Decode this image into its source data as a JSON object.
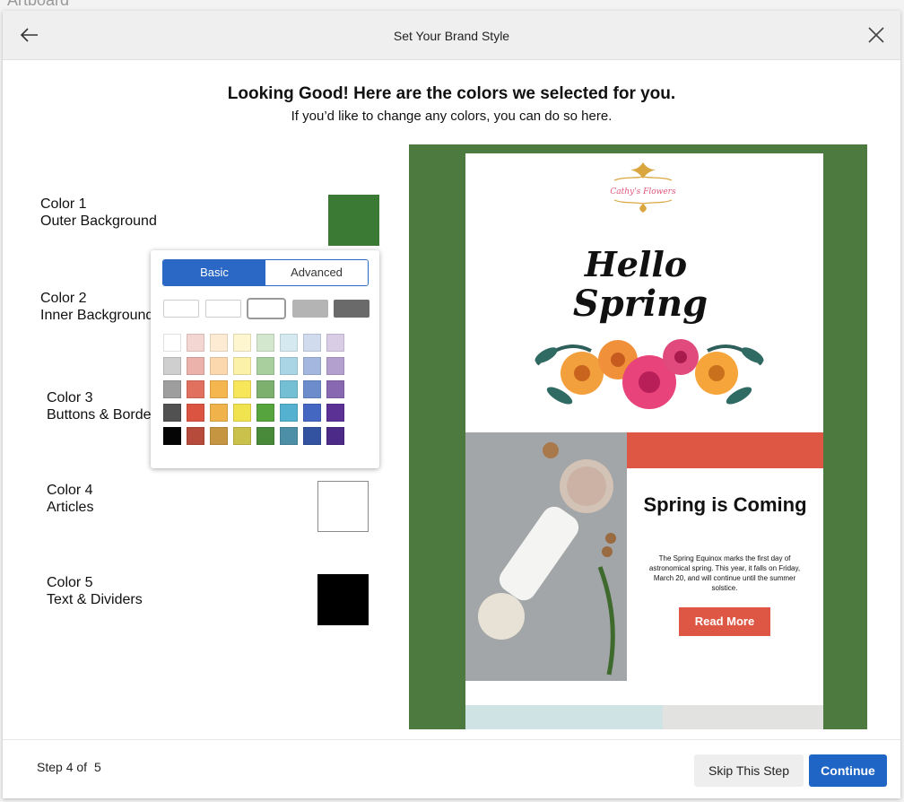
{
  "artboard_label": "Artboard",
  "header": {
    "title": "Set Your Brand Style"
  },
  "intro": {
    "headline": "Looking Good! Here are the colors we selected for you.",
    "subline": "If you’d like to change any colors, you can do so here."
  },
  "colors": [
    {
      "name": "Color 1",
      "role": "Outer Background",
      "value": "#3a7a35"
    },
    {
      "name": "Color 2",
      "role": "Inner Background",
      "value": "#ffffff"
    },
    {
      "name": "Color 3",
      "role": "Buttons & Borders",
      "value": "#dd5744"
    },
    {
      "name": "Color 4",
      "role": "Articles",
      "value": "#ffffff"
    },
    {
      "name": "Color 5",
      "role": "Text & Dividers",
      "value": "#000000"
    }
  ],
  "picker": {
    "tabs": [
      "Basic",
      "Advanced"
    ],
    "presets": [
      "#ffffff",
      "#ffffff",
      "#ffffff",
      "#b4b4b4",
      "#6a6a6a"
    ],
    "grid": [
      [
        "#ffffff",
        "#f3d6d2",
        "#fdebd4",
        "#fdf6cf",
        "#d3e7cf",
        "#d5e9f1",
        "#d0dbed",
        "#d9cde5",
        "#ecd1e6"
      ],
      [
        "#cfcfcf",
        "#ebb2ab",
        "#fbd8ae",
        "#fbf1a8",
        "#a9cf9f",
        "#a9d5e5",
        "#a4b7df",
        "#b3a0ce",
        "#dbadd5"
      ],
      [
        "#9e9e9e",
        "#e1705f",
        "#f6b64f",
        "#f7e65a",
        "#7db06f",
        "#74bfd4",
        "#6d8ccc",
        "#8869b1",
        "#c36fb8"
      ],
      [
        "#515151",
        "#db5442",
        "#f0b34b",
        "#f1e34f",
        "#56a43e",
        "#55b1d0",
        "#4467c2",
        "#5b3196",
        "#b544a3"
      ],
      [
        "#050505",
        "#b74b3b",
        "#c69541",
        "#c9c14b",
        "#48893a",
        "#4c8fa7",
        "#3353a1",
        "#4b2a88",
        "#973a86"
      ]
    ]
  },
  "preview": {
    "logo_text": "Cathy's Flowers",
    "hello_line1": "Hello",
    "hello_line2": "Spring",
    "article_title": "Spring is Coming",
    "article_body": "The Spring Equinox marks the first day of astronomical spring. This year, it falls on Friday, March 20, and will continue until the summer solstice.",
    "read_more": "Read More"
  },
  "footer": {
    "step_label": "Step 4 of",
    "step_total": "5",
    "skip_label": "Skip This Step",
    "continue_label": "Continue"
  }
}
